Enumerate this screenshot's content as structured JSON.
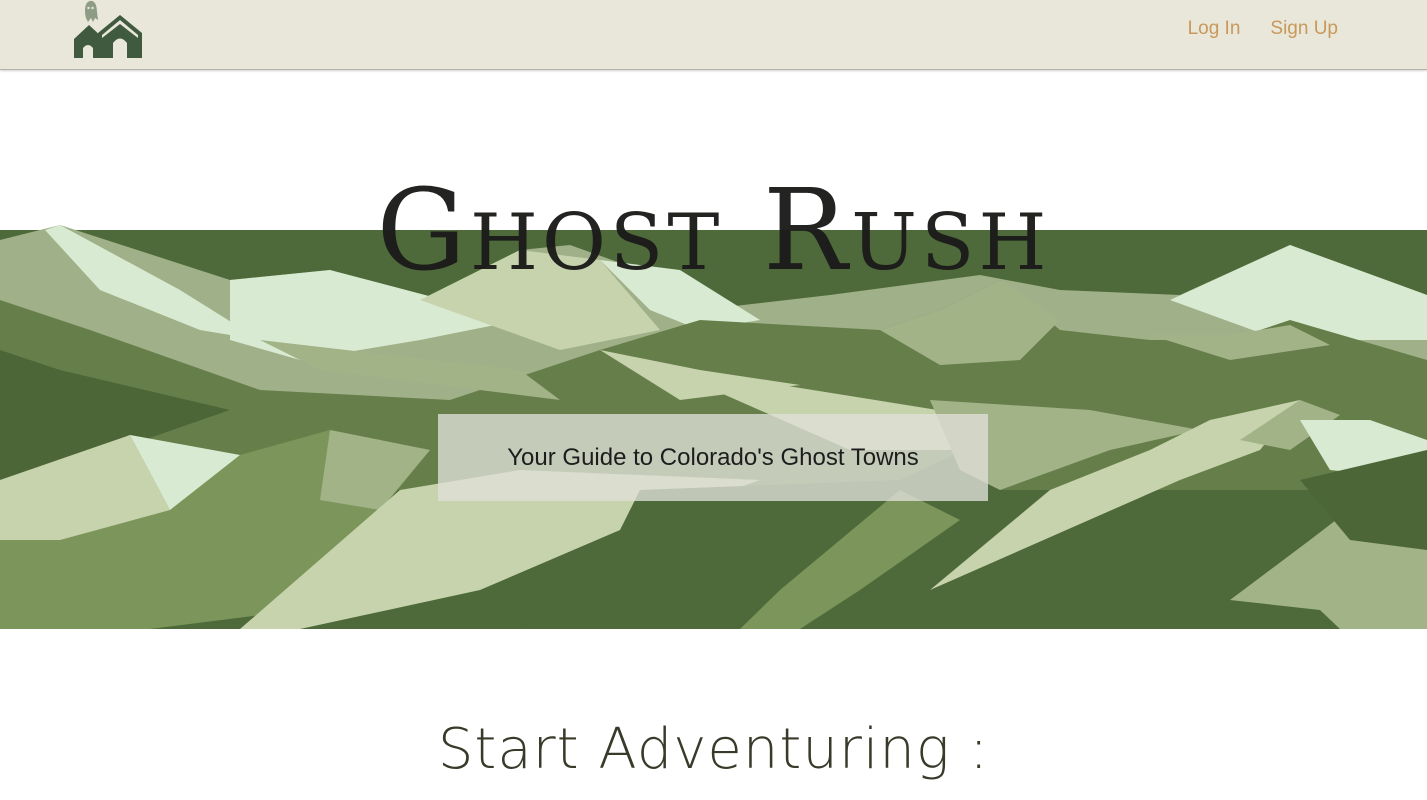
{
  "header": {
    "logo_icon": "ghost-houses-logo",
    "nav": [
      {
        "label": "Log In"
      },
      {
        "label": "Sign Up"
      }
    ],
    "link_color": "#c8995a",
    "background": "#e9e6da"
  },
  "hero": {
    "title": "Ghost Rush",
    "tagline": "Your Guide to Colorado's Ghost Towns",
    "palette": [
      "#4c6638",
      "#667f4a",
      "#7b955a",
      "#a2b388",
      "#c7d3ac",
      "#d9ebd2"
    ]
  },
  "main": {
    "section_title": "Start Adventuring :"
  }
}
